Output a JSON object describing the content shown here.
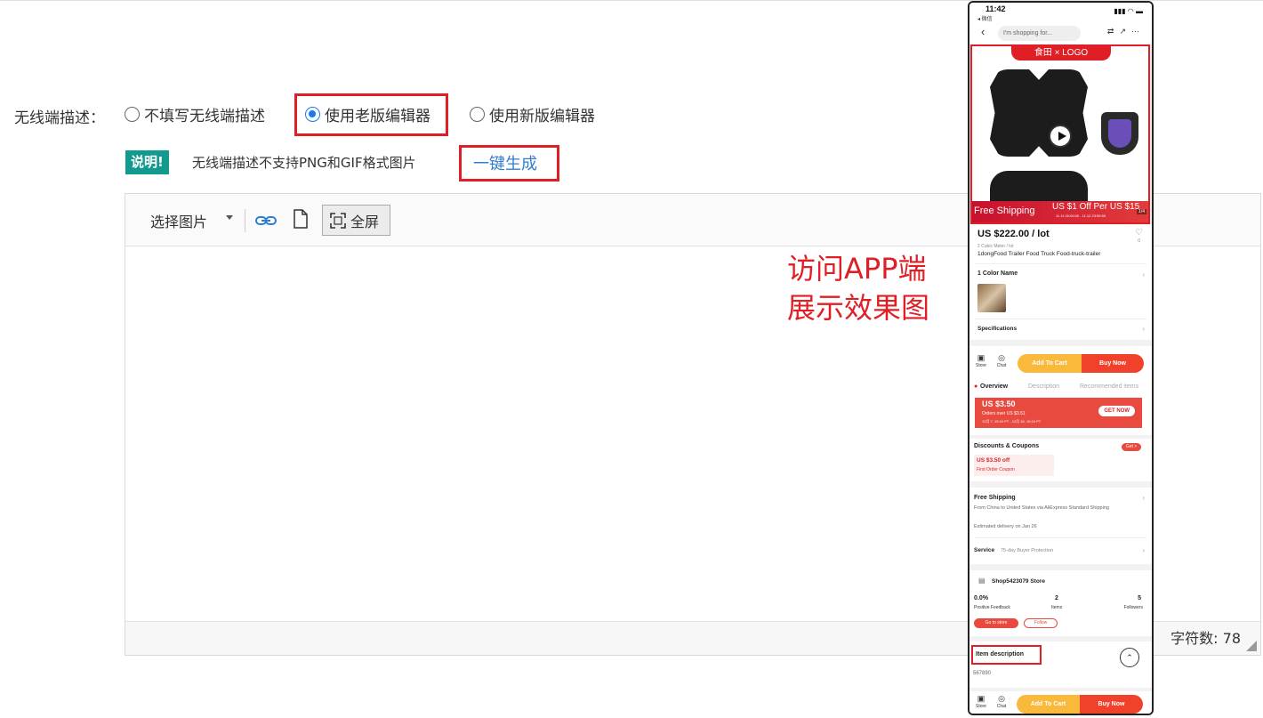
{
  "form": {
    "label": "无线端描述：",
    "options": [
      {
        "label": "不填写无线端描述",
        "selected": false
      },
      {
        "label": "使用老版编辑器",
        "selected": true
      },
      {
        "label": "使用新版编辑器",
        "selected": false
      }
    ],
    "tip_badge": "说明!",
    "tip_text": "无线端描述不支持PNG和GIF格式图片",
    "generate_link": "一键生成"
  },
  "editor": {
    "select_image": "选择图片",
    "fullscreen": "全屏",
    "char_count_label": "字符数：",
    "char_count_value": "78",
    "char_count_full": "字符数: 78"
  },
  "annotation": {
    "line1": "访问APP端",
    "line2": "展示效果图"
  },
  "phone": {
    "time": "11:42",
    "back_app": "◂ 微信",
    "search_placeholder": "I'm shopping for...",
    "hero_logo": "⾷⽥ × LOGO",
    "free_shipping": "Free Shipping",
    "promo": "US $1 Off Per US $15",
    "promo_date": "11.11  00:00:00 - 11.12  23:59:59",
    "image_index": "1/4",
    "price": "US $222.00 / lot",
    "unit": "2 Cubic Meter / lot",
    "title": "1dongFood Trailer Food Truck Food-truck-trailer",
    "color_name": "1 Color Name",
    "specifications": "Specifications",
    "store": "Store",
    "chat": "Chat",
    "add_to_cart": "Add To Cart",
    "buy_now": "Buy Now",
    "tab_overview": "Overview",
    "tab_description": "Description",
    "tab_recommended": "Recommended items",
    "coupon_amount": "US $3.50",
    "coupon_condition": "Orders over US $3.51",
    "coupon_date": "12月 7, 19:24 PT - 12月 16, 19:24 PT",
    "get_now": "GET NOW",
    "discounts_title": "Discounts & Coupons",
    "get": "Get >",
    "small_coupon_amount": "US $3.50 off",
    "small_coupon_text": "First Order Coupon",
    "free_shipping_title": "Free Shipping",
    "shipping_detail": "From China to United States via AliExpress Standard Shipping",
    "estimated": "Estimated delivery on Jan 26",
    "service_label": "Service",
    "service_value": "75-day Buyer Protection",
    "store_name": "Shop5423079 Store",
    "feedback_value": "0.0%",
    "feedback_label": "Positive Feedback",
    "items_value": "2",
    "items_label": "Items",
    "followers_value": "5",
    "followers_label": "Followers",
    "go_to_store": "Go to store",
    "follow": "Follow",
    "item_description": "Item description",
    "desc_value": "567890",
    "wishlist_count": "0"
  }
}
